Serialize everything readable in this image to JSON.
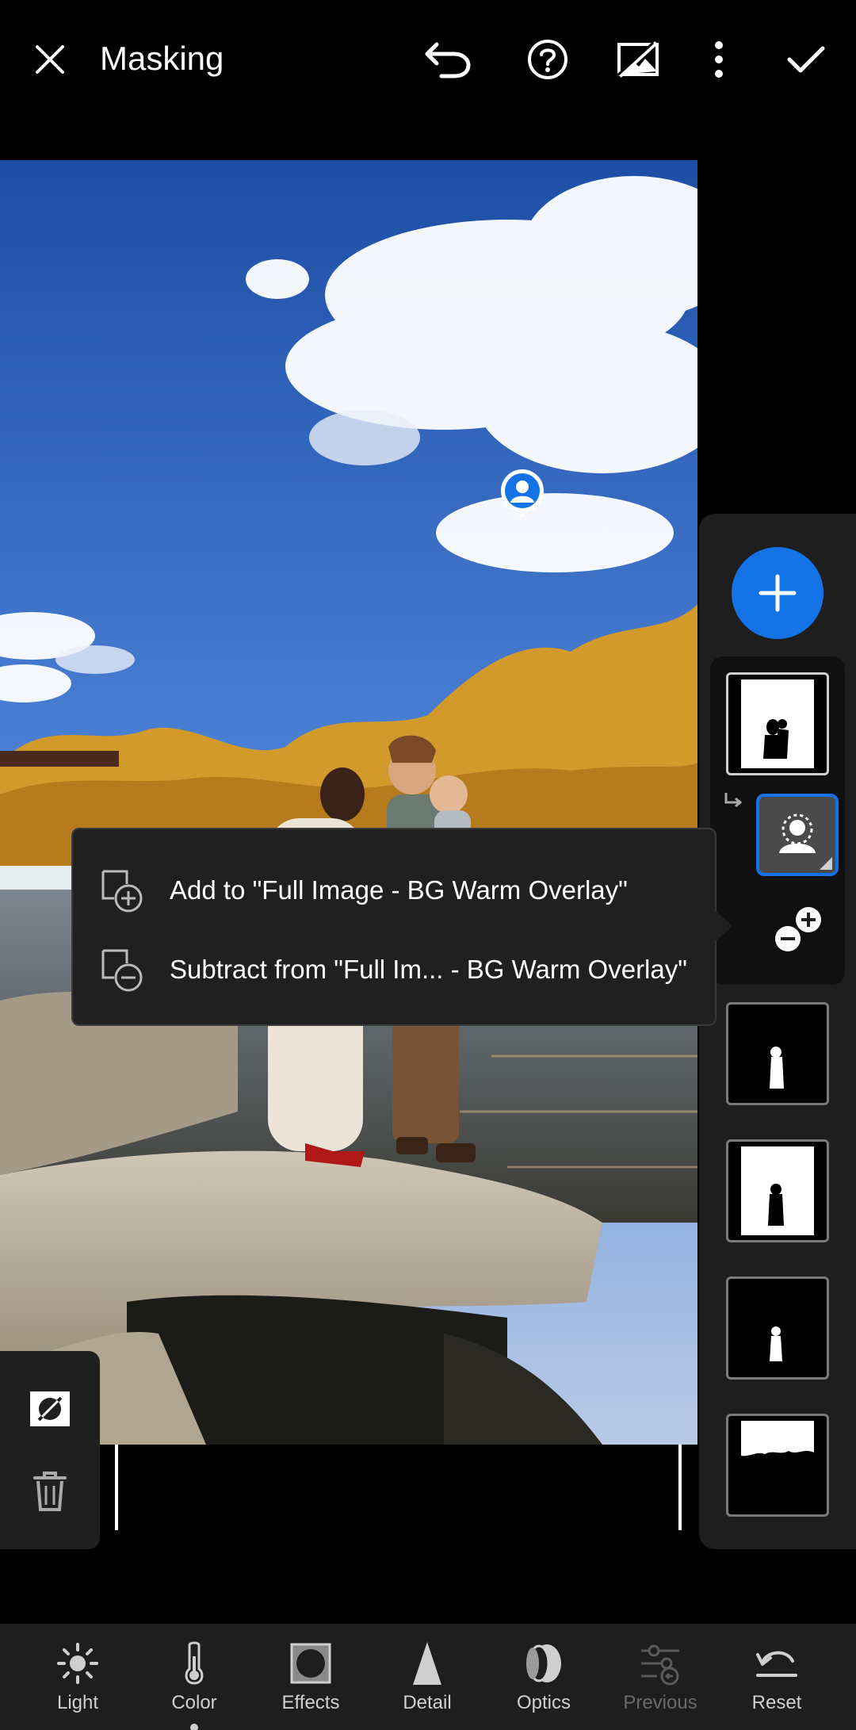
{
  "header": {
    "title": "Masking"
  },
  "popup": {
    "items": [
      {
        "label": "Add to \"Full Image - BG Warm Overlay\""
      },
      {
        "label": "Subtract from \"Full Im... - BG Warm Overlay\""
      }
    ]
  },
  "toolbar": {
    "items": [
      {
        "label": "Light"
      },
      {
        "label": "Color"
      },
      {
        "label": "Effects"
      },
      {
        "label": "Detail"
      },
      {
        "label": "Optics"
      },
      {
        "label": "Previous"
      },
      {
        "label": "Reset"
      }
    ]
  },
  "colors": {
    "accent": "#1473e6",
    "panel": "#1e1e1e",
    "background": "#000000"
  }
}
